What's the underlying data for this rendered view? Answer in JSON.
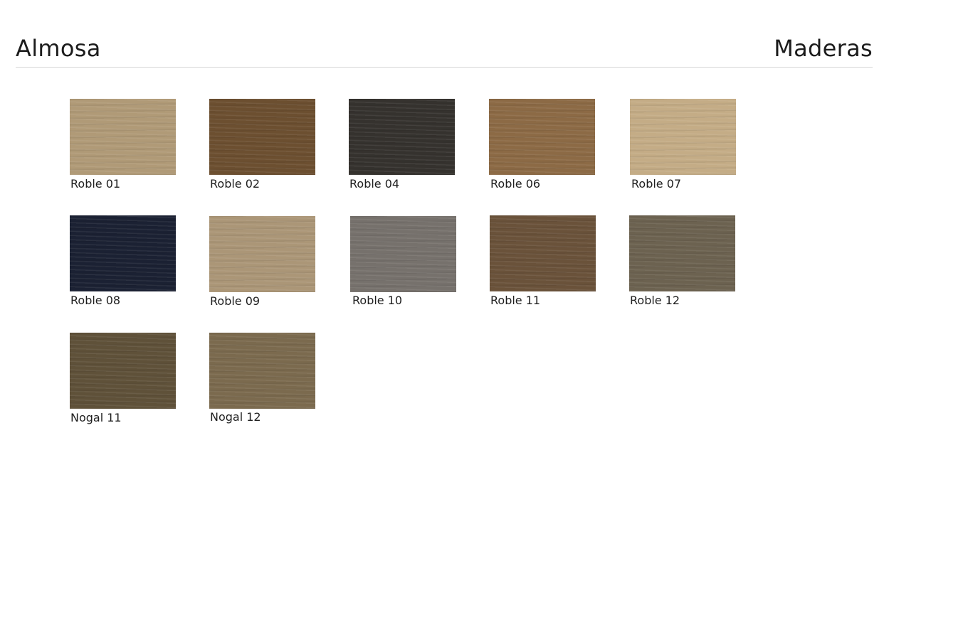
{
  "header": {
    "product": "Almosa",
    "category": "Maderas"
  },
  "swatches": [
    {
      "label": "Roble 01",
      "color": "#b09a77"
    },
    {
      "label": "Roble 02",
      "color": "#6c4f30"
    },
    {
      "label": "Roble 04",
      "color": "#35322e"
    },
    {
      "label": "Roble 06",
      "color": "#8c6a45"
    },
    {
      "label": "Roble 07",
      "color": "#c4ac86"
    },
    {
      "label": "Roble 08",
      "color": "#1b2133"
    },
    {
      "label": "Roble 09",
      "color": "#ab9677"
    },
    {
      "label": "Roble 10",
      "color": "#76716c"
    },
    {
      "label": "Roble 11",
      "color": "#6a523a"
    },
    {
      "label": "Roble 12",
      "color": "#6c6250"
    },
    {
      "label": "Nogal 11",
      "color": "#5f5139"
    },
    {
      "label": "Nogal 12",
      "color": "#7b6a4e"
    }
  ]
}
